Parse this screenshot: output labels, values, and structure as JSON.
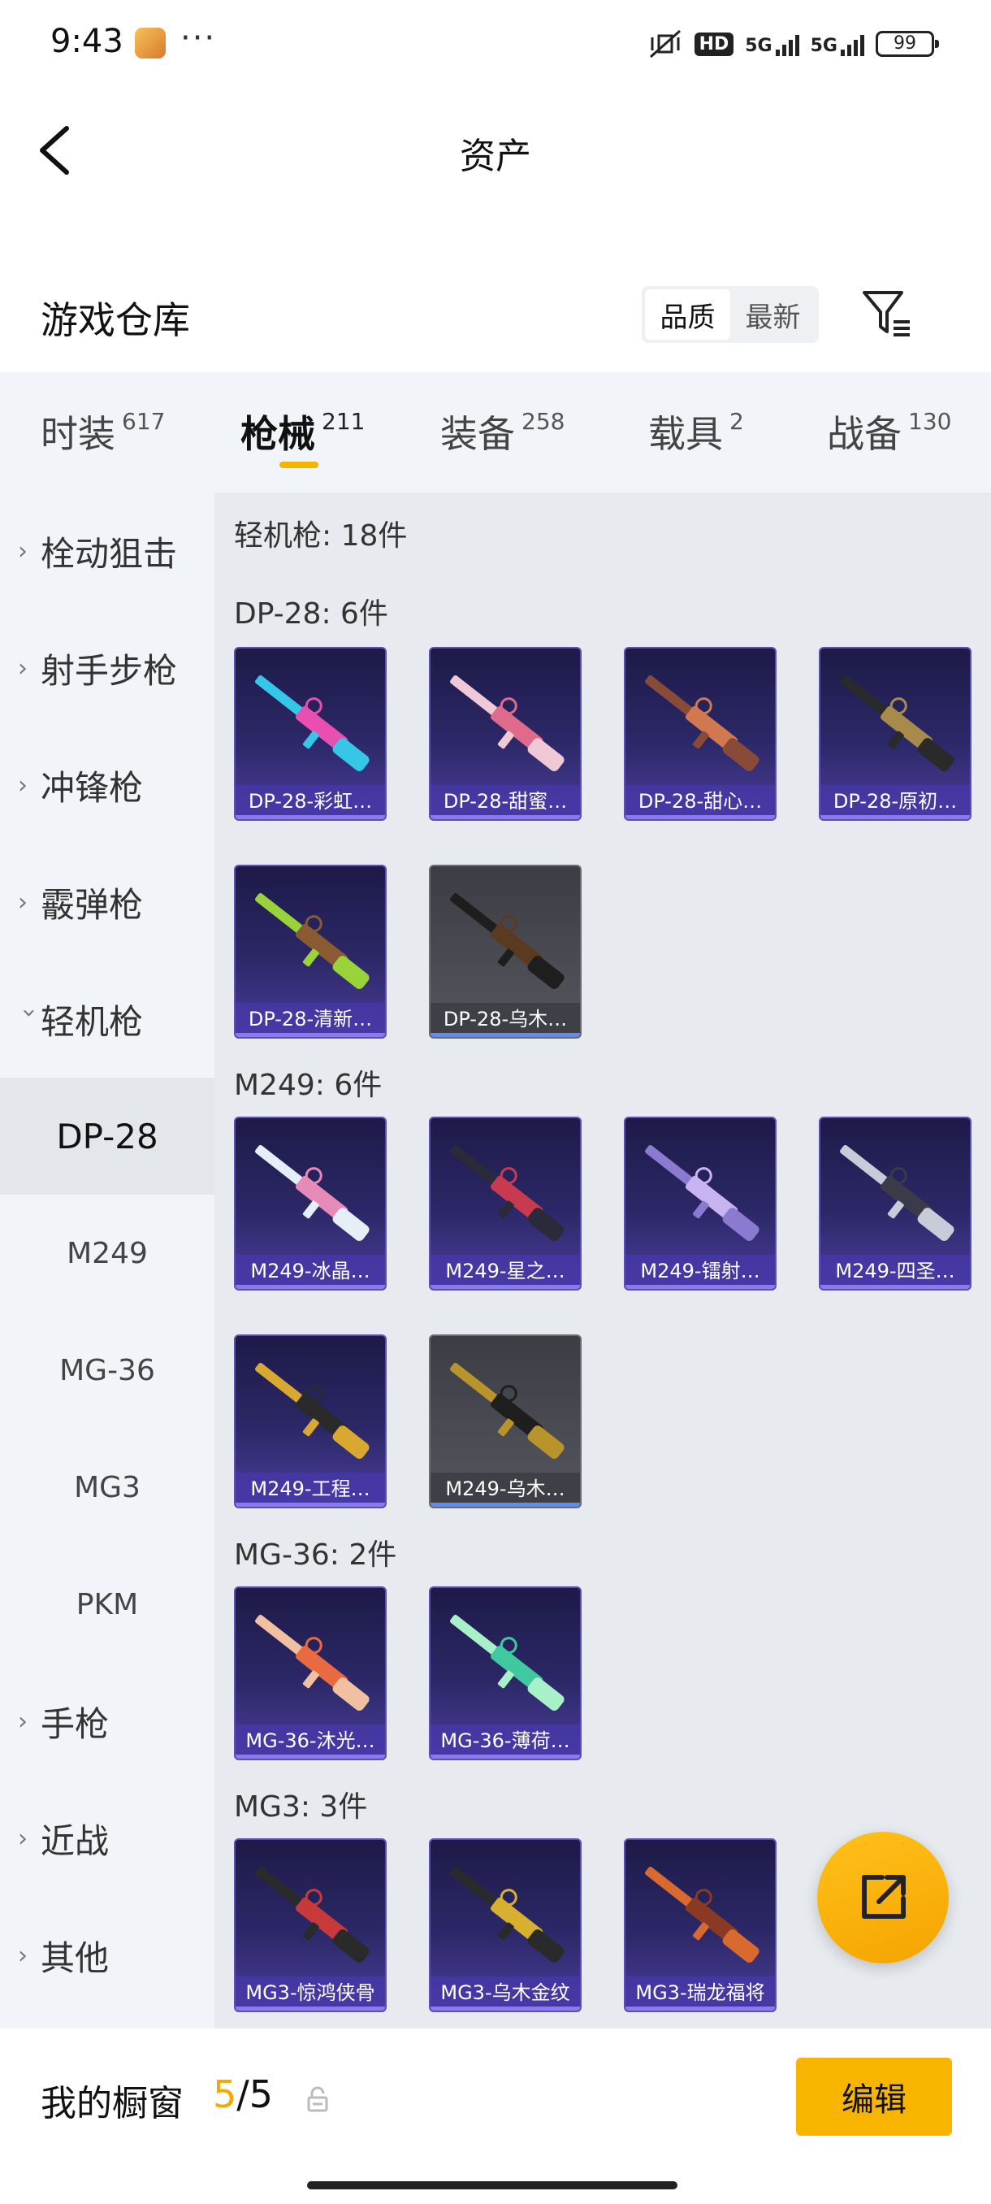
{
  "status_bar": {
    "time": "9:43",
    "dots": "···",
    "hd": "HD",
    "net1": "5G",
    "net2": "5G",
    "battery": "99"
  },
  "header": {
    "title": "资产"
  },
  "section": {
    "title": "游戏仓库",
    "sort_options": [
      "品质",
      "最新"
    ],
    "sort_active": "品质"
  },
  "tabs": [
    {
      "label": "时装",
      "count": "617"
    },
    {
      "label": "枪械",
      "count": "211"
    },
    {
      "label": "装备",
      "count": "258"
    },
    {
      "label": "载具",
      "count": "2"
    },
    {
      "label": "战备",
      "count": "130"
    }
  ],
  "active_tab": "枪械",
  "sidebar": {
    "categories": [
      "栓动狙击",
      "射手步枪",
      "冲锋枪",
      "霰弹枪",
      "轻机枪",
      "手枪",
      "近战",
      "其他"
    ],
    "expanded": "轻机枪",
    "subitems": [
      "DP-28",
      "M249",
      "MG-36",
      "MG3",
      "PKM"
    ],
    "active_sub": "DP-28"
  },
  "content": {
    "category_heading": "轻机枪: 18件",
    "groups": [
      {
        "heading": "DP-28: 6件",
        "items": [
          "DP-28-彩虹…",
          "DP-28-甜蜜…",
          "DP-28-甜心…",
          "DP-28-原初…",
          "DP-28-清新…",
          "DP-28-乌木…"
        ]
      },
      {
        "heading": "M249: 6件",
        "items": [
          "M249-冰晶…",
          "M249-星之…",
          "M249-镭射…",
          "M249-四圣…",
          "M249-工程…",
          "M249-乌木…"
        ]
      },
      {
        "heading": "MG-36: 2件",
        "items": [
          "MG-36-沐光…",
          "MG-36-薄荷…"
        ]
      },
      {
        "heading": "MG3: 3件",
        "items": [
          "MG3-惊鸿侠骨",
          "MG3-乌木金纹",
          "MG3-瑞龙福将"
        ]
      }
    ]
  },
  "bottom_bar": {
    "label": "我的橱窗",
    "current": "5",
    "separator": "/",
    "total": "5",
    "edit_label": "编辑"
  },
  "colors": {
    "accent": "#f5b400",
    "card_purple": "#2c2868",
    "card_grey": "#55565e"
  },
  "icons": {
    "back": "back-chevron-icon",
    "filter": "filter-icon",
    "share": "share-export-icon",
    "lock": "lock-icon"
  }
}
